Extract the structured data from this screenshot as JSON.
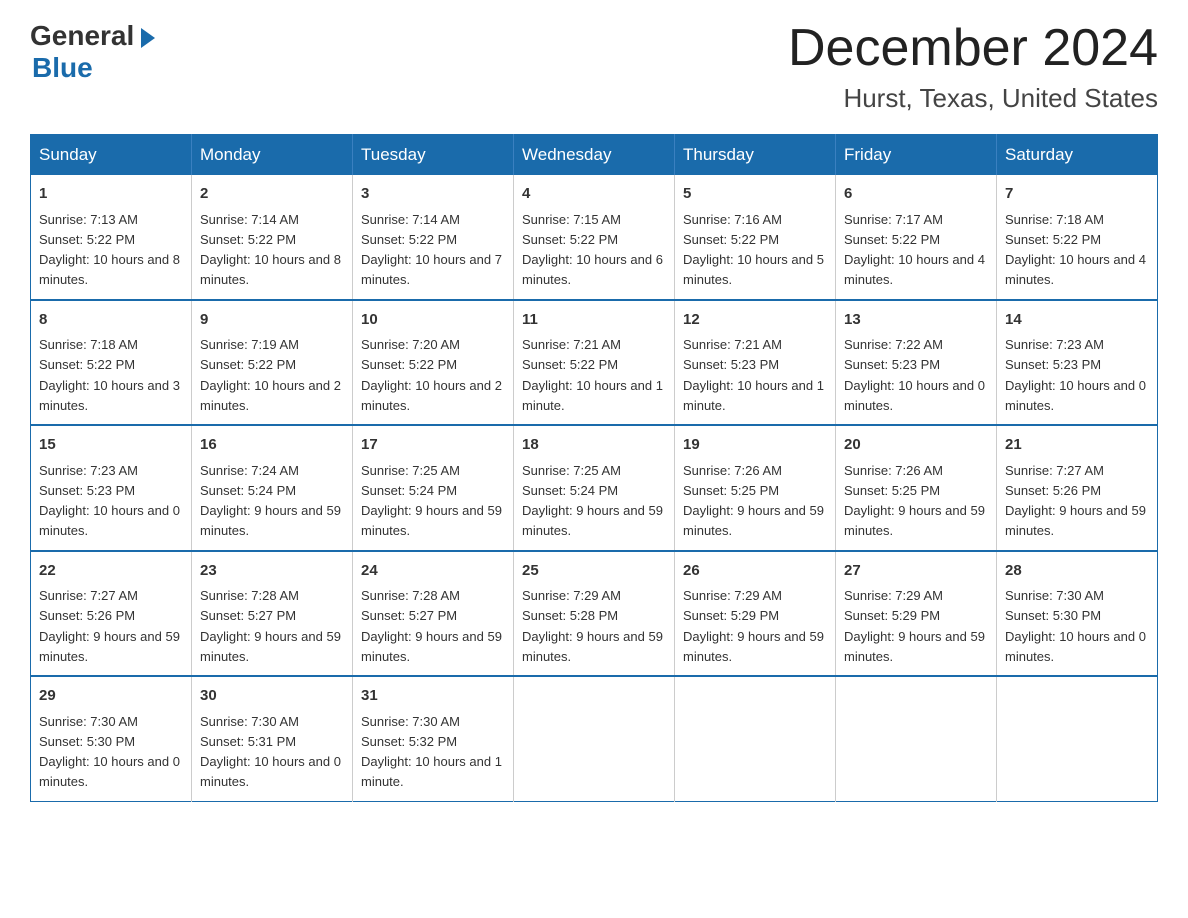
{
  "logo": {
    "general": "General",
    "blue": "Blue",
    "triangle": "▶"
  },
  "title": "December 2024",
  "subtitle": "Hurst, Texas, United States",
  "days_of_week": [
    "Sunday",
    "Monday",
    "Tuesday",
    "Wednesday",
    "Thursday",
    "Friday",
    "Saturday"
  ],
  "weeks": [
    [
      {
        "day": "1",
        "sunrise": "7:13 AM",
        "sunset": "5:22 PM",
        "daylight": "10 hours and 8 minutes."
      },
      {
        "day": "2",
        "sunrise": "7:14 AM",
        "sunset": "5:22 PM",
        "daylight": "10 hours and 8 minutes."
      },
      {
        "day": "3",
        "sunrise": "7:14 AM",
        "sunset": "5:22 PM",
        "daylight": "10 hours and 7 minutes."
      },
      {
        "day": "4",
        "sunrise": "7:15 AM",
        "sunset": "5:22 PM",
        "daylight": "10 hours and 6 minutes."
      },
      {
        "day": "5",
        "sunrise": "7:16 AM",
        "sunset": "5:22 PM",
        "daylight": "10 hours and 5 minutes."
      },
      {
        "day": "6",
        "sunrise": "7:17 AM",
        "sunset": "5:22 PM",
        "daylight": "10 hours and 4 minutes."
      },
      {
        "day": "7",
        "sunrise": "7:18 AM",
        "sunset": "5:22 PM",
        "daylight": "10 hours and 4 minutes."
      }
    ],
    [
      {
        "day": "8",
        "sunrise": "7:18 AM",
        "sunset": "5:22 PM",
        "daylight": "10 hours and 3 minutes."
      },
      {
        "day": "9",
        "sunrise": "7:19 AM",
        "sunset": "5:22 PM",
        "daylight": "10 hours and 2 minutes."
      },
      {
        "day": "10",
        "sunrise": "7:20 AM",
        "sunset": "5:22 PM",
        "daylight": "10 hours and 2 minutes."
      },
      {
        "day": "11",
        "sunrise": "7:21 AM",
        "sunset": "5:22 PM",
        "daylight": "10 hours and 1 minute."
      },
      {
        "day": "12",
        "sunrise": "7:21 AM",
        "sunset": "5:23 PM",
        "daylight": "10 hours and 1 minute."
      },
      {
        "day": "13",
        "sunrise": "7:22 AM",
        "sunset": "5:23 PM",
        "daylight": "10 hours and 0 minutes."
      },
      {
        "day": "14",
        "sunrise": "7:23 AM",
        "sunset": "5:23 PM",
        "daylight": "10 hours and 0 minutes."
      }
    ],
    [
      {
        "day": "15",
        "sunrise": "7:23 AM",
        "sunset": "5:23 PM",
        "daylight": "10 hours and 0 minutes."
      },
      {
        "day": "16",
        "sunrise": "7:24 AM",
        "sunset": "5:24 PM",
        "daylight": "9 hours and 59 minutes."
      },
      {
        "day": "17",
        "sunrise": "7:25 AM",
        "sunset": "5:24 PM",
        "daylight": "9 hours and 59 minutes."
      },
      {
        "day": "18",
        "sunrise": "7:25 AM",
        "sunset": "5:24 PM",
        "daylight": "9 hours and 59 minutes."
      },
      {
        "day": "19",
        "sunrise": "7:26 AM",
        "sunset": "5:25 PM",
        "daylight": "9 hours and 59 minutes."
      },
      {
        "day": "20",
        "sunrise": "7:26 AM",
        "sunset": "5:25 PM",
        "daylight": "9 hours and 59 minutes."
      },
      {
        "day": "21",
        "sunrise": "7:27 AM",
        "sunset": "5:26 PM",
        "daylight": "9 hours and 59 minutes."
      }
    ],
    [
      {
        "day": "22",
        "sunrise": "7:27 AM",
        "sunset": "5:26 PM",
        "daylight": "9 hours and 59 minutes."
      },
      {
        "day": "23",
        "sunrise": "7:28 AM",
        "sunset": "5:27 PM",
        "daylight": "9 hours and 59 minutes."
      },
      {
        "day": "24",
        "sunrise": "7:28 AM",
        "sunset": "5:27 PM",
        "daylight": "9 hours and 59 minutes."
      },
      {
        "day": "25",
        "sunrise": "7:29 AM",
        "sunset": "5:28 PM",
        "daylight": "9 hours and 59 minutes."
      },
      {
        "day": "26",
        "sunrise": "7:29 AM",
        "sunset": "5:29 PM",
        "daylight": "9 hours and 59 minutes."
      },
      {
        "day": "27",
        "sunrise": "7:29 AM",
        "sunset": "5:29 PM",
        "daylight": "9 hours and 59 minutes."
      },
      {
        "day": "28",
        "sunrise": "7:30 AM",
        "sunset": "5:30 PM",
        "daylight": "10 hours and 0 minutes."
      }
    ],
    [
      {
        "day": "29",
        "sunrise": "7:30 AM",
        "sunset": "5:30 PM",
        "daylight": "10 hours and 0 minutes."
      },
      {
        "day": "30",
        "sunrise": "7:30 AM",
        "sunset": "5:31 PM",
        "daylight": "10 hours and 0 minutes."
      },
      {
        "day": "31",
        "sunrise": "7:30 AM",
        "sunset": "5:32 PM",
        "daylight": "10 hours and 1 minute."
      },
      null,
      null,
      null,
      null
    ]
  ]
}
